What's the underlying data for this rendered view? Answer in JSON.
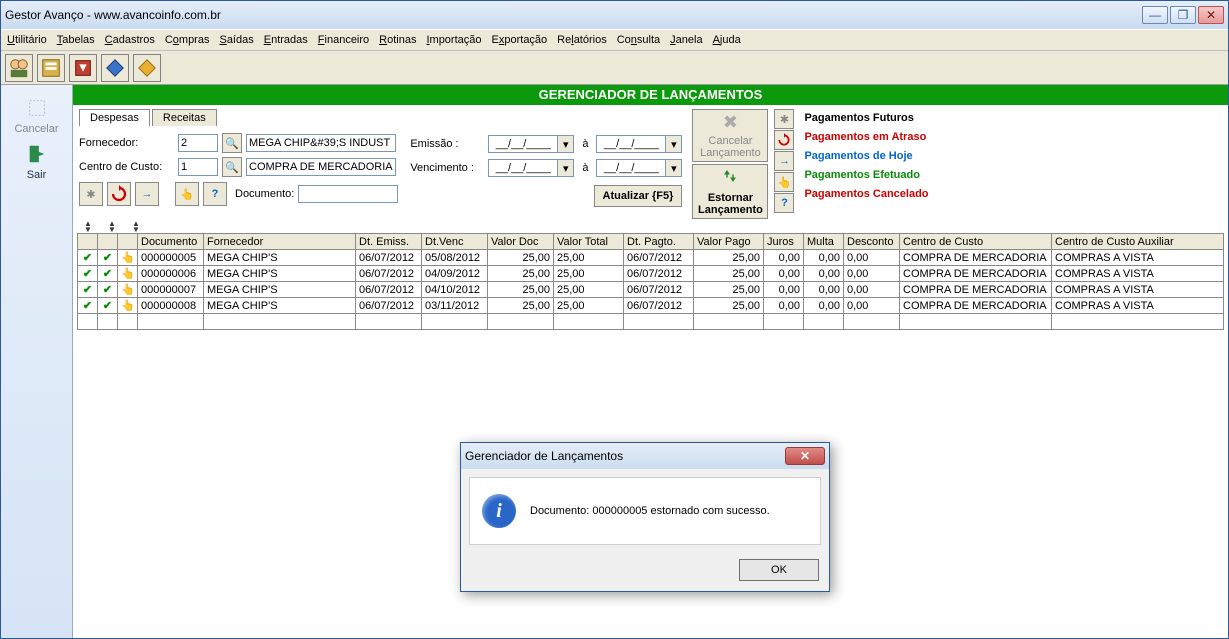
{
  "window": {
    "title": "Gestor Avanço - www.avancoinfo.com.br"
  },
  "menu": [
    "Utilitário",
    "Tabelas",
    "Cadastros",
    "Compras",
    "Saídas",
    "Entradas",
    "Financeiro",
    "Rotinas",
    "Importação",
    "Exportação",
    "Relatórios",
    "Consulta",
    "Janela",
    "Ajuda"
  ],
  "sidebar": {
    "cancelar": "Cancelar",
    "sair": "Sair"
  },
  "banner": "GERENCIADOR DE LANÇAMENTOS",
  "tabs": {
    "despesas": "Despesas",
    "receitas": "Receitas"
  },
  "filters": {
    "fornecedor_label": "Fornecedor:",
    "fornecedor_code": "2",
    "fornecedor_name": "MEGA CHIP&#39;S INDUST",
    "centro_label": "Centro de Custo:",
    "centro_code": "1",
    "centro_name": "COMPRA DE MERCADORIA",
    "documento_label": "Documento:",
    "documento_value": "",
    "emissao_label": "Emissão :",
    "vencimento_label": "Vencimento :",
    "date_placeholder": "__/__/____",
    "a_label": "à"
  },
  "buttons": {
    "atualizar": "Atualizar {F5}",
    "cancelar_lanc": "Cancelar Lançamento",
    "estornar_lanc": "Estornar Lançamento"
  },
  "legend": {
    "futuros": "Pagamentos Futuros",
    "atraso": "Pagamentos em Atraso",
    "hoje": "Pagamentos de Hoje",
    "efetuado": "Pagamentos Efetuado",
    "cancelado": "Pagamentos Cancelado"
  },
  "table": {
    "headers": [
      "",
      "",
      "",
      "Documento",
      "Fornecedor",
      "Dt. Emiss.",
      "Dt.Venc",
      "Valor Doc",
      "Valor Total",
      "Dt. Pagto.",
      "Valor Pago",
      "Juros",
      "Multa",
      "Desconto",
      "Centro de Custo",
      "Centro de Custo Auxiliar"
    ],
    "rows": [
      {
        "documento": "000000005",
        "fornecedor": "MEGA CHIP&#39;S",
        "emiss": "06/07/2012",
        "venc": "05/08/2012",
        "vdoc": "25,00",
        "vtotal": "25,00",
        "pagto": "06/07/2012",
        "vpago": "25,00",
        "juros": "0,00",
        "multa": "0,00",
        "desc": "0,00",
        "cc": "COMPRA DE MERCADORIA",
        "ccaux": "COMPRAS A VISTA"
      },
      {
        "documento": "000000006",
        "fornecedor": "MEGA CHIP&#39;S",
        "emiss": "06/07/2012",
        "venc": "04/09/2012",
        "vdoc": "25,00",
        "vtotal": "25,00",
        "pagto": "06/07/2012",
        "vpago": "25,00",
        "juros": "0,00",
        "multa": "0,00",
        "desc": "0,00",
        "cc": "COMPRA DE MERCADORIA",
        "ccaux": "COMPRAS A VISTA"
      },
      {
        "documento": "000000007",
        "fornecedor": "MEGA CHIP&#39;S",
        "emiss": "06/07/2012",
        "venc": "04/10/2012",
        "vdoc": "25,00",
        "vtotal": "25,00",
        "pagto": "06/07/2012",
        "vpago": "25,00",
        "juros": "0,00",
        "multa": "0,00",
        "desc": "0,00",
        "cc": "COMPRA DE MERCADORIA",
        "ccaux": "COMPRAS A VISTA"
      },
      {
        "documento": "000000008",
        "fornecedor": "MEGA CHIP&#39;S",
        "emiss": "06/07/2012",
        "venc": "03/11/2012",
        "vdoc": "25,00",
        "vtotal": "25,00",
        "pagto": "06/07/2012",
        "vpago": "25,00",
        "juros": "0,00",
        "multa": "0,00",
        "desc": "0,00",
        "cc": "COMPRA DE MERCADORIA",
        "ccaux": "COMPRAS A VISTA"
      }
    ]
  },
  "dialog": {
    "title": "Gerenciador de Lançamentos",
    "message": "Documento: 000000005 estornado com sucesso.",
    "ok": "OK"
  }
}
